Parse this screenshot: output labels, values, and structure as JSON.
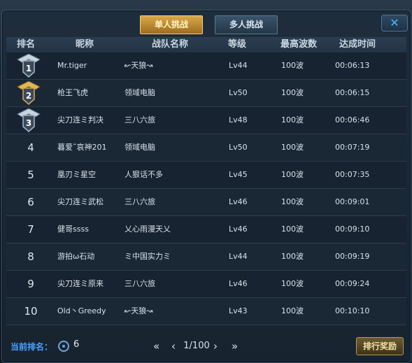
{
  "tabs": {
    "single": "单人挑战",
    "multi": "多人挑战"
  },
  "close_label": "✕",
  "columns": {
    "rank": "排名",
    "nickname": "昵称",
    "team": "战队名称",
    "level": "等级",
    "max_wave": "最高波数",
    "time": "达成时间"
  },
  "rows": [
    {
      "rank": "1",
      "nickname": "Mr.tiger",
      "team": "↜天狼↝",
      "level": "Lv44",
      "max_wave": "100波",
      "time": "00:06:13",
      "medal": "silver"
    },
    {
      "rank": "2",
      "nickname": "枪王飞虎",
      "team": "领域电脑",
      "level": "Lv50",
      "max_wave": "100波",
      "time": "00:06:15",
      "medal": "gold"
    },
    {
      "rank": "3",
      "nickname": "尖刀连ミ判决",
      "team": "三八六旅",
      "level": "Lv48",
      "max_wave": "100波",
      "time": "00:06:46",
      "medal": "silver"
    },
    {
      "rank": "4",
      "nickname": "暮爱˜哀神201",
      "team": "领域电脑",
      "level": "Lv50",
      "max_wave": "100波",
      "time": "00:07:19"
    },
    {
      "rank": "5",
      "nickname": "凰刃ミ星空",
      "team": "人狠话不多",
      "level": "Lv45",
      "max_wave": "100波",
      "time": "00:07:35"
    },
    {
      "rank": "6",
      "nickname": "尖刀连ミ武松",
      "team": "三八六旅",
      "level": "Lv46",
      "max_wave": "100波",
      "time": "00:09:01"
    },
    {
      "rank": "7",
      "nickname": "健哥ssss",
      "team": "乂心雨漫天乂",
      "level": "Lv46",
      "max_wave": "100波",
      "time": "00:09:10"
    },
    {
      "rank": "8",
      "nickname": "游拍ω石动",
      "team": "ミ中国实力ミ",
      "level": "Lv44",
      "max_wave": "100波",
      "time": "00:09:19"
    },
    {
      "rank": "9",
      "nickname": "尖刀连ミ原来",
      "team": "三八六旅",
      "level": "Lv46",
      "max_wave": "100波",
      "time": "00:09:24"
    },
    {
      "rank": "10",
      "nickname": "Old丶Greedy",
      "team": "↜天狼↝",
      "level": "Lv43",
      "max_wave": "100波",
      "time": "00:10:10"
    }
  ],
  "footer": {
    "current_rank_label": "当前排名：",
    "current_rank_value": "6",
    "page_text": "1/100",
    "first": "«",
    "prev": "‹",
    "next": "›",
    "last": "»",
    "reward_button": "排行奖励"
  },
  "colors": {
    "gold": "#d9a84a",
    "silver": "#aab8c6",
    "accent_blue": "#4aa3ff"
  }
}
